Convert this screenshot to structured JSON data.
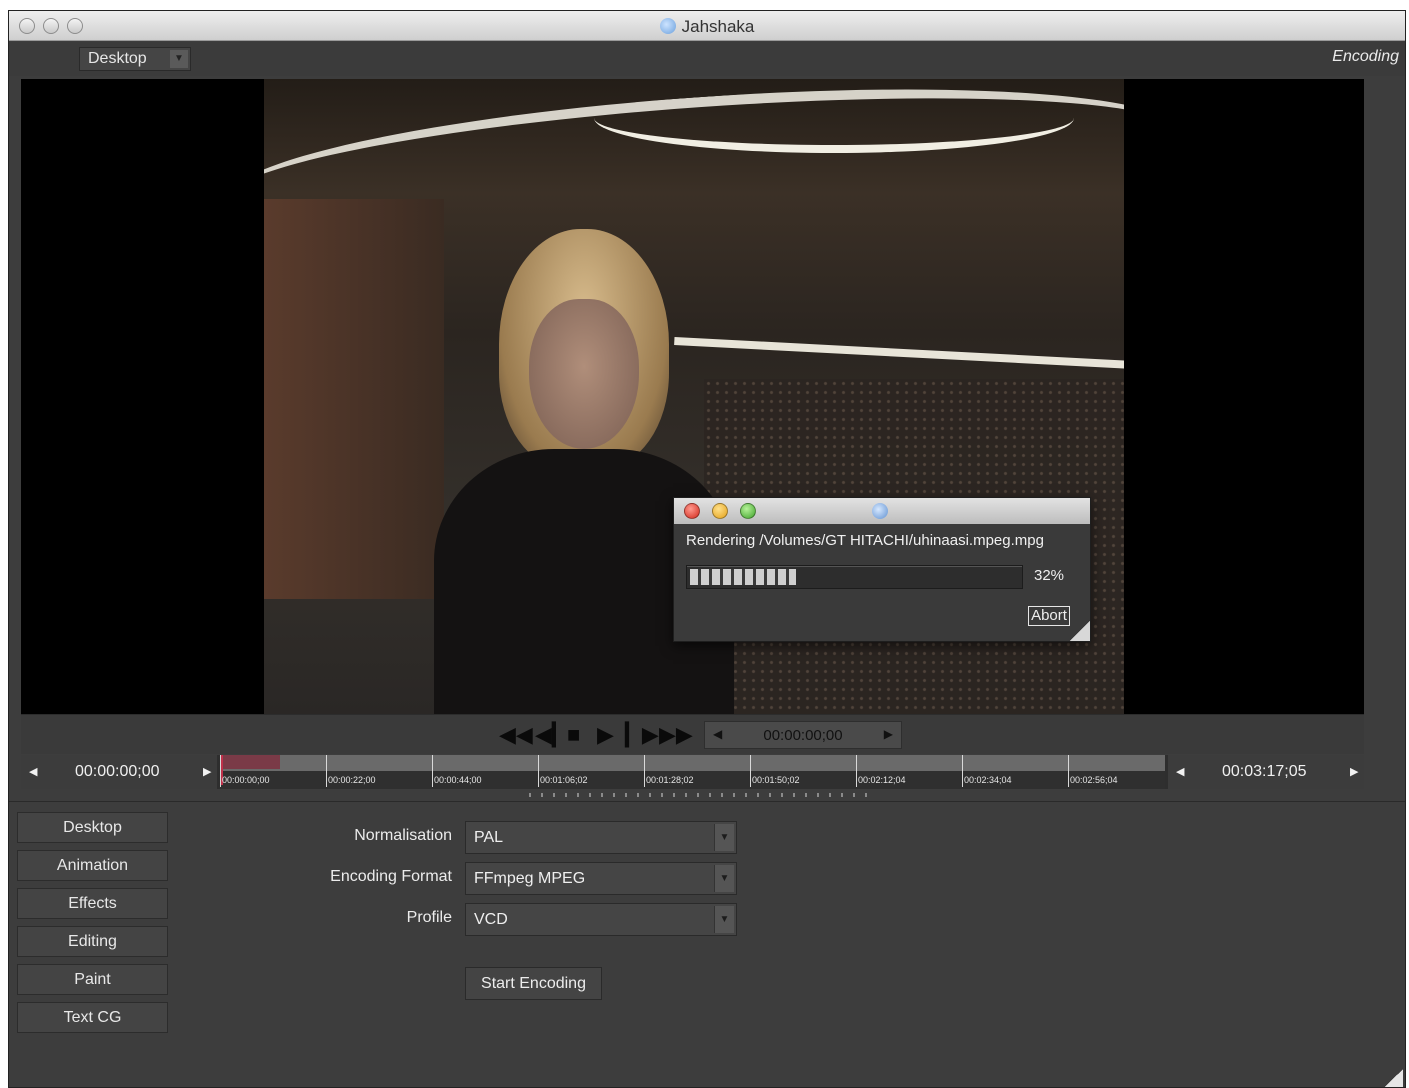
{
  "window": {
    "title": "Jahshaka"
  },
  "topbar": {
    "desktop_select": "Desktop",
    "mode_label": "Encoding"
  },
  "render_dialog": {
    "message": "Rendering /Volumes/GT HITACHI/uhinaasi.mpeg.mpg",
    "progress": 0.32,
    "progress_text": "32%",
    "abort_label": "Abort"
  },
  "transport": {
    "timecode": "00:00:00;00",
    "buttons": [
      "rewind-to-start",
      "step-back",
      "stop",
      "play",
      "step-forward",
      "fast-forward"
    ]
  },
  "timeline": {
    "start_tc": "00:00:00;00",
    "end_tc": "00:03:17;05",
    "ticks": [
      "00:00:00;00",
      "00:00:22;00",
      "00:00:44;00",
      "00:01:06;02",
      "00:01:28;02",
      "00:01:50;02",
      "00:02:12;04",
      "00:02:34;04",
      "00:02:56;04"
    ]
  },
  "modules": [
    "Desktop",
    "Animation",
    "Effects",
    "Editing",
    "Paint",
    "Text CG"
  ],
  "encoding": {
    "normalisation_label": "Normalisation",
    "normalisation_value": "PAL",
    "format_label": "Encoding Format",
    "format_value": "FFmpeg MPEG",
    "profile_label": "Profile",
    "profile_value": "VCD",
    "start_label": "Start Encoding"
  },
  "colors": {
    "accent": "#c0304a",
    "panel": "#3d3d3d",
    "viewer_bg": "#000000"
  }
}
